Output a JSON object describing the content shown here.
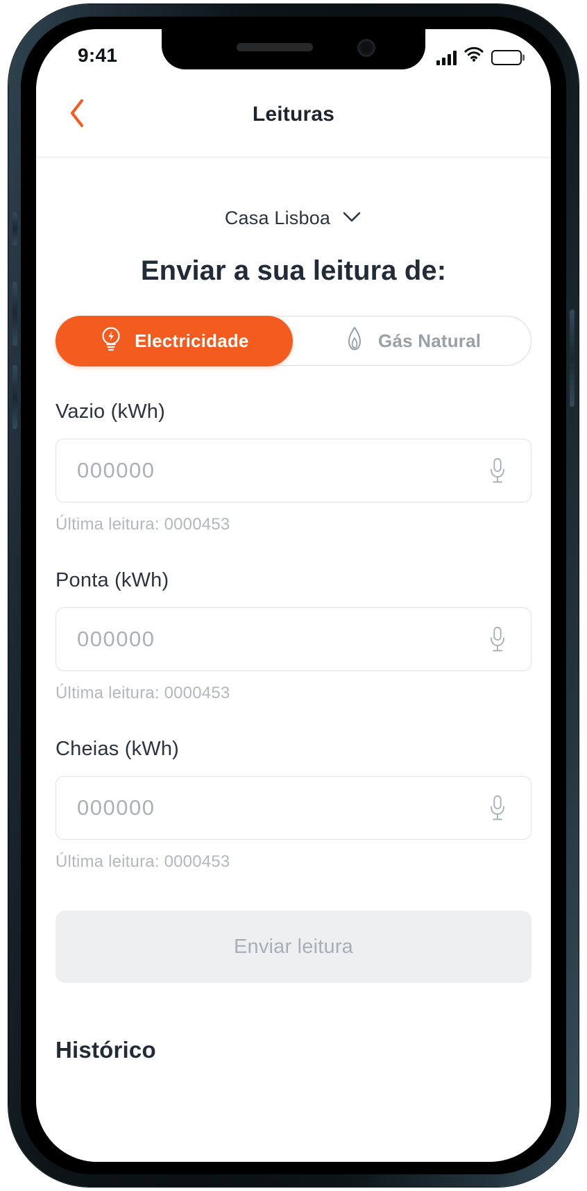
{
  "status_bar": {
    "time": "9:41",
    "signal_icon": "cellular-signal-icon",
    "wifi_icon": "wifi-icon",
    "battery_icon": "battery-full-icon"
  },
  "nav": {
    "back_icon": "chevron-left-icon",
    "title": "Leituras"
  },
  "property": {
    "name": "Casa Lisboa",
    "chevron_icon": "chevron-down-icon"
  },
  "heading": "Enviar a sua leitura de:",
  "toggle": {
    "options": [
      {
        "label": "Electricidade",
        "icon": "lightbulb-icon",
        "active": true
      },
      {
        "label": "Gás Natural",
        "icon": "flame-icon",
        "active": false
      }
    ]
  },
  "fields": [
    {
      "label": "Vazio (kWh)",
      "value": "",
      "placeholder": "000000",
      "mic_icon": "microphone-icon",
      "hint": "Última leitura: 0000453"
    },
    {
      "label": "Ponta (kWh)",
      "value": "",
      "placeholder": "000000",
      "mic_icon": "microphone-icon",
      "hint": "Última leitura: 0000453"
    },
    {
      "label": "Cheias (kWh)",
      "value": "",
      "placeholder": "000000",
      "mic_icon": "microphone-icon",
      "hint": "Última leitura: 0000453"
    }
  ],
  "submit": {
    "label": "Enviar leitura",
    "enabled": false
  },
  "history": {
    "heading": "Histórico"
  },
  "colors": {
    "accent": "#f45b1f",
    "text_dark": "#222b38",
    "text_muted": "#b2b8be",
    "border": "#dfe2e5",
    "disabled_bg": "#eeeff1"
  }
}
